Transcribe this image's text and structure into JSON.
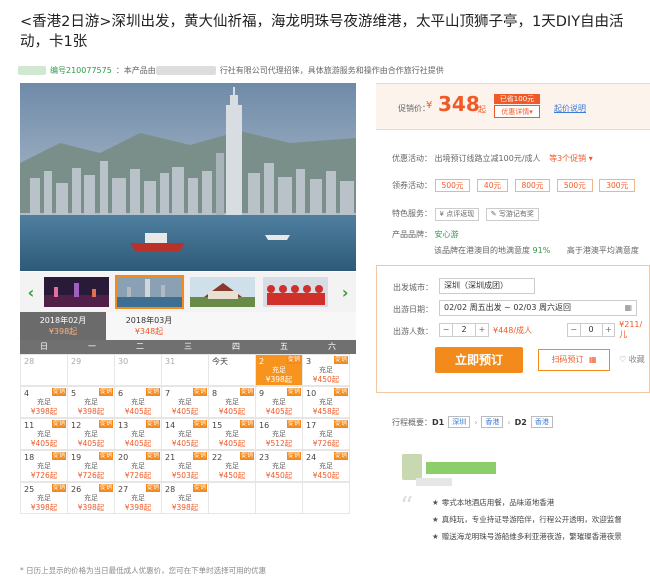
{
  "title": "<香港2日游>深圳出发，黄大仙祈福，海龙明珠号夜游维港，太平山顶狮子亭，1天DIY自由活动，卡1张",
  "subline": {
    "tag": "编号",
    "code": "编号210077575",
    "text1": "：本产品由",
    "text2": "行社有限公司代理招徕，具体旅游服务和操作由合作旅行社提供"
  },
  "months": [
    {
      "label": "2018年02月",
      "price": "¥398起"
    },
    {
      "label": "2018年03月",
      "price": "¥348起"
    }
  ],
  "weekdays": [
    "日",
    "一",
    "二",
    "三",
    "四",
    "五",
    "六"
  ],
  "calendar": [
    [
      {
        "d": "28",
        "g": true
      },
      {
        "d": "29",
        "g": true
      },
      {
        "d": "30",
        "g": true
      },
      {
        "d": "31",
        "g": true
      },
      {
        "d": "今天"
      },
      {
        "d": "2",
        "c": "充足",
        "p": "¥398起",
        "sel": true,
        "bx": "促销"
      },
      {
        "d": "3",
        "c": "充足",
        "p": "¥450起",
        "bx": "促销"
      }
    ],
    [
      {
        "d": "4",
        "c": "充足",
        "p": "¥398起",
        "bx": "促销"
      },
      {
        "d": "5",
        "c": "充足",
        "p": "¥398起",
        "bx": "促销"
      },
      {
        "d": "6",
        "c": "充足",
        "p": "¥405起",
        "bx": "促销"
      },
      {
        "d": "7",
        "c": "充足",
        "p": "¥405起",
        "bx": "促销"
      },
      {
        "d": "8",
        "c": "充足",
        "p": "¥405起",
        "bx": "促销"
      },
      {
        "d": "9",
        "c": "充足",
        "p": "¥405起",
        "bx": "促销"
      },
      {
        "d": "10",
        "c": "充足",
        "p": "¥458起",
        "bx": "促销"
      }
    ],
    [
      {
        "d": "11",
        "c": "充足",
        "p": "¥405起",
        "bx": "促销"
      },
      {
        "d": "12",
        "c": "充足",
        "p": "¥405起",
        "bx": "促销"
      },
      {
        "d": "13",
        "c": "充足",
        "p": "¥405起",
        "bx": "促销"
      },
      {
        "d": "14",
        "c": "充足",
        "p": "¥405起",
        "bx": "促销"
      },
      {
        "d": "15",
        "c": "充足",
        "p": "¥405起",
        "bx": "促销"
      },
      {
        "d": "16",
        "c": "充足",
        "p": "¥512起",
        "bx": "促销"
      },
      {
        "d": "17",
        "c": "充足",
        "p": "¥726起",
        "bx": "促销"
      }
    ],
    [
      {
        "d": "18",
        "c": "充足",
        "p": "¥726起",
        "bx": "促销"
      },
      {
        "d": "19",
        "c": "充足",
        "p": "¥726起",
        "bx": "促销"
      },
      {
        "d": "20",
        "c": "充足",
        "p": "¥726起",
        "bx": "促销"
      },
      {
        "d": "21",
        "c": "充足",
        "p": "¥503起",
        "bx": "促销"
      },
      {
        "d": "22",
        "c": "充足",
        "p": "¥450起",
        "bx": "促销"
      },
      {
        "d": "23",
        "c": "充足",
        "p": "¥450起",
        "bx": "促销"
      },
      {
        "d": "24",
        "c": "充足",
        "p": "¥450起",
        "bx": "促销"
      }
    ],
    [
      {
        "d": "25",
        "c": "充足",
        "p": "¥398起",
        "bx": "促销"
      },
      {
        "d": "26",
        "c": "充足",
        "p": "¥398起",
        "bx": "促销"
      },
      {
        "d": "27",
        "c": "充足",
        "p": "¥398起",
        "bx": "促销"
      },
      {
        "d": "28",
        "c": "充足",
        "p": "¥398起",
        "bx": "促销"
      },
      {
        "d": ""
      },
      {
        "d": ""
      },
      {
        "d": ""
      }
    ]
  ],
  "note": "* 日历上显示的价格为当日最低成人优惠价，您可在下单时选择可用的优惠",
  "price": {
    "label": "促销价：",
    "currency": "¥",
    "amount": "348",
    "suffix": "起",
    "saved": "已省100元",
    "detail": "优惠详情▾",
    "explain": "起价说明"
  },
  "promo": {
    "label": "优惠活动：",
    "text": "出境预订线路立减100元/成人",
    "more": "等3个促销 ▾"
  },
  "coupons": {
    "label": "领券活动：",
    "items": [
      "500元",
      "40元",
      "800元",
      "500元",
      "300元"
    ]
  },
  "services": {
    "label": "特色服务：",
    "items": [
      "¥ 点评返现",
      "✎ 写游记有奖"
    ]
  },
  "brand": {
    "label": "产品品牌：",
    "name": "安心游",
    "sat_label": "该品牌在港澳目的地满意度",
    "sat_value": "91%",
    "compare": "高于港澳平均满意度"
  },
  "booking": {
    "city_label": "出发城市：",
    "city_value": "深圳（深圳成团）",
    "date_label": "出游日期：",
    "date_value": "02/02 周五出发 ~ 02/03 周六返回",
    "count_label": "出游人数：",
    "adult_count": "2",
    "adult_price": "¥448/成人",
    "child_count": "0",
    "child_price": "¥211/儿",
    "book_button": "立即预订",
    "scan_button": "扫码预订",
    "fav_button": "♡ 收藏"
  },
  "itinerary": {
    "label": "行程概要：",
    "d1": "D1",
    "d1a": "深圳",
    "d1b": "香港",
    "d2": "D2",
    "d2a": "香港"
  },
  "review": {
    "lines": [
      "零式本地酒店用餐，品味道地香港",
      "真纯玩，专业持证导游陪伴，行程公开透明，欢迎监督",
      "赠送海龙明珠号游船维多利亚港夜游，繁璀璨香港夜景"
    ]
  }
}
